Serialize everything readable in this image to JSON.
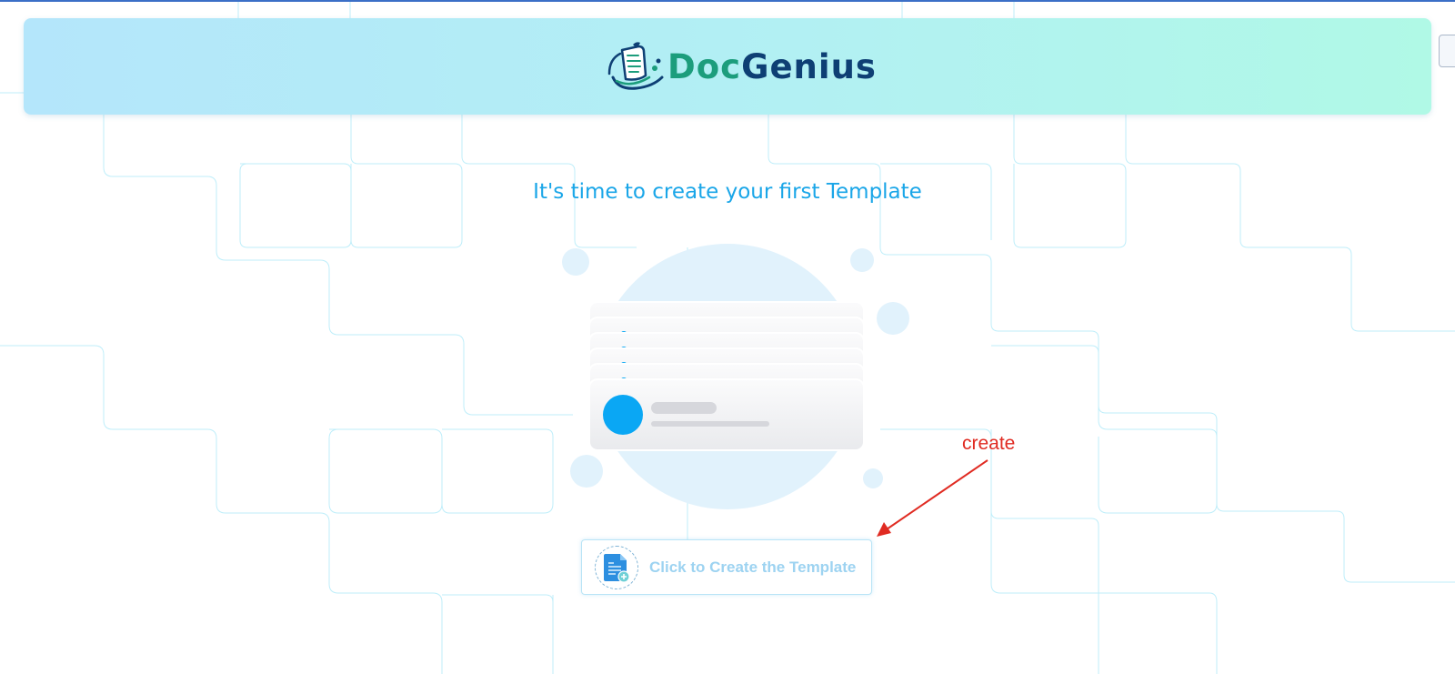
{
  "header": {
    "logo_part1": "Doc",
    "logo_part2": "Genius"
  },
  "main": {
    "headline": "It's time to create your first Template",
    "create_button_label": "Click to Create the Template"
  },
  "annotation": {
    "label": "create",
    "color": "#e02b22"
  },
  "colors": {
    "accent": "#1aa6e8",
    "logo_green": "#1c9d7c",
    "logo_navy": "#0e3f74",
    "card_avatar": "#0aa7f4"
  },
  "icons": {
    "logo": "document-quill-icon",
    "button": "document-add-icon",
    "side": "expand-icon"
  }
}
